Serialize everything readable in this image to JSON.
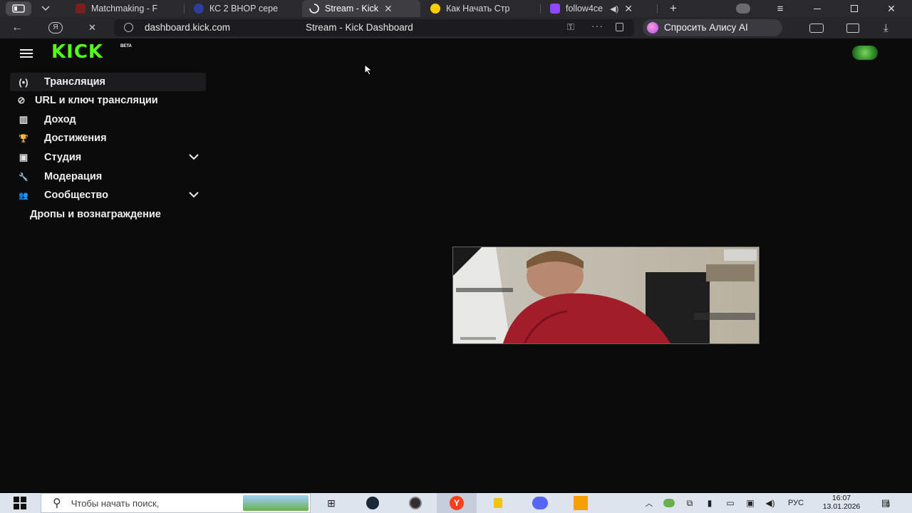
{
  "browser": {
    "tabs": [
      {
        "title": "Matchmaking - F",
        "favicon_color": "#c0392b"
      },
      {
        "title": "КС 2 ВНОР сере",
        "favicon_color": "#5b6cff"
      },
      {
        "title": "Stream - Kick",
        "favicon_color": "#ffffff"
      },
      {
        "title": "Как Начать Стр",
        "favicon_color": "#ffcc00"
      },
      {
        "title": "follow4ce",
        "favicon_color": "#9146ff"
      }
    ],
    "new_tab_label": "+",
    "address": "dashboard.kick.com",
    "page_title": "Stream - Kick Dashboard",
    "alice_label": "Спросить Алису AI",
    "reload_label": "✕"
  },
  "kick": {
    "logo": "KICK",
    "beta": "BETA",
    "accent": "#53fc18",
    "nav": [
      {
        "label": "Трансляция",
        "icon": "broadcast-icon",
        "glyph": "(•)"
      },
      {
        "label": "URL и ключ трансляции",
        "icon": "link-icon",
        "glyph": "⊘"
      },
      {
        "label": "Доход",
        "icon": "chart-icon",
        "glyph": "▥"
      },
      {
        "label": "Достижения",
        "icon": "trophy-icon",
        "glyph": "🏆"
      },
      {
        "label": "Студия",
        "icon": "studio-icon",
        "glyph": "▣"
      },
      {
        "label": "Модерация",
        "icon": "wrench-icon",
        "glyph": "🔧"
      },
      {
        "label": "Сообщество",
        "icon": "users-icon",
        "glyph": "👥"
      }
    ],
    "subnav": {
      "label": "Дропы и вознаграждение"
    }
  },
  "taskbar": {
    "search_placeholder": "Чтобы начать поиск,",
    "lang": "РУС",
    "time": "16:07",
    "date": "13.01.2026",
    "notifications": "8"
  }
}
